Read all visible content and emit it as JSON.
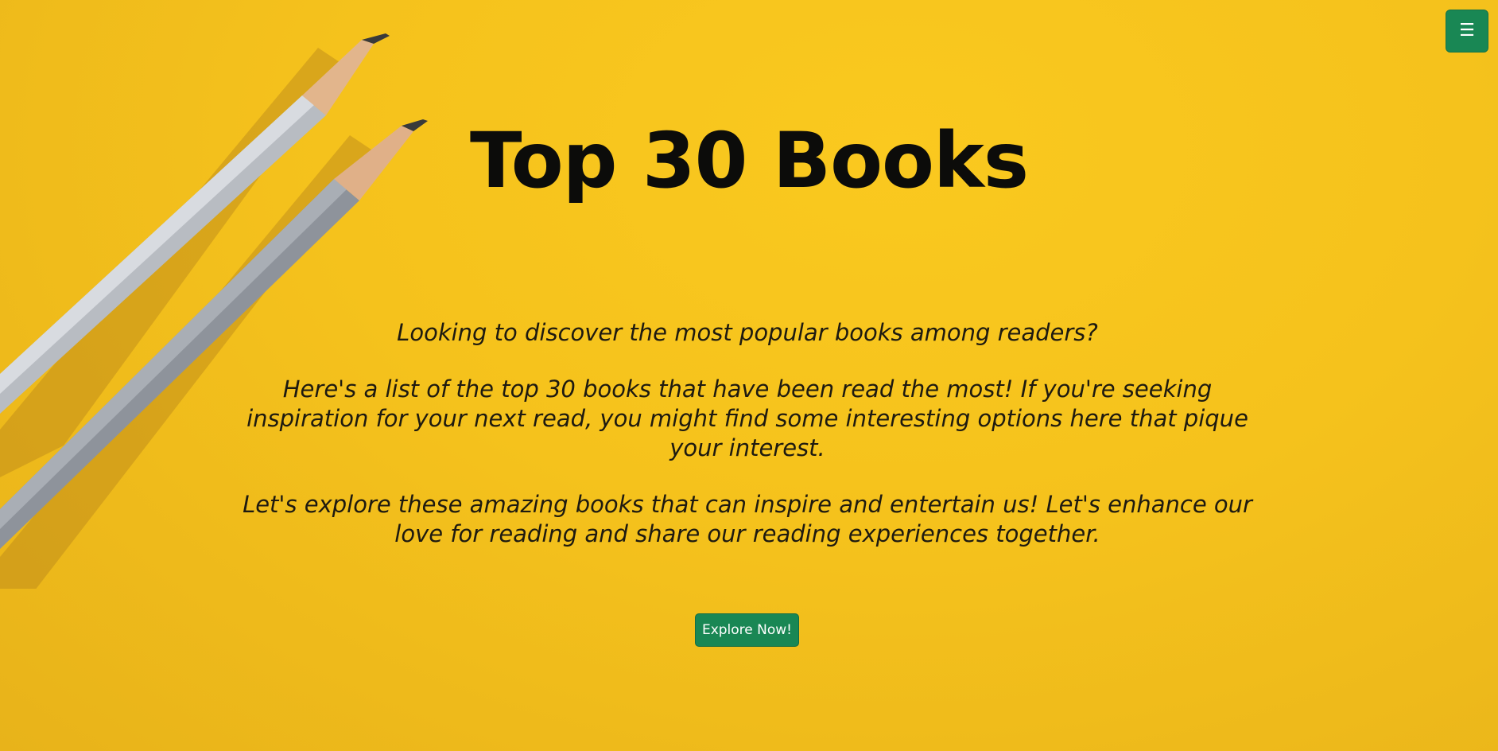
{
  "hero": {
    "title": "Top 30 Books",
    "paragraphs": [
      "Looking to discover the most popular books among readers?",
      "Here's a list of the top 30 books that have been read the most! If you're seeking inspiration for your next read, you might find some interesting options here that pique your interest.",
      "Let's explore these amazing books that can inspire and entertain us! Let's enhance our love for reading and share our reading experiences together."
    ],
    "cta_label": "Explore Now!"
  },
  "menu": {
    "icon": "menu-icon",
    "glyph": "☰"
  },
  "colors": {
    "background": "#f5c21c",
    "button": "#198754",
    "text": "#0c0c0a"
  }
}
